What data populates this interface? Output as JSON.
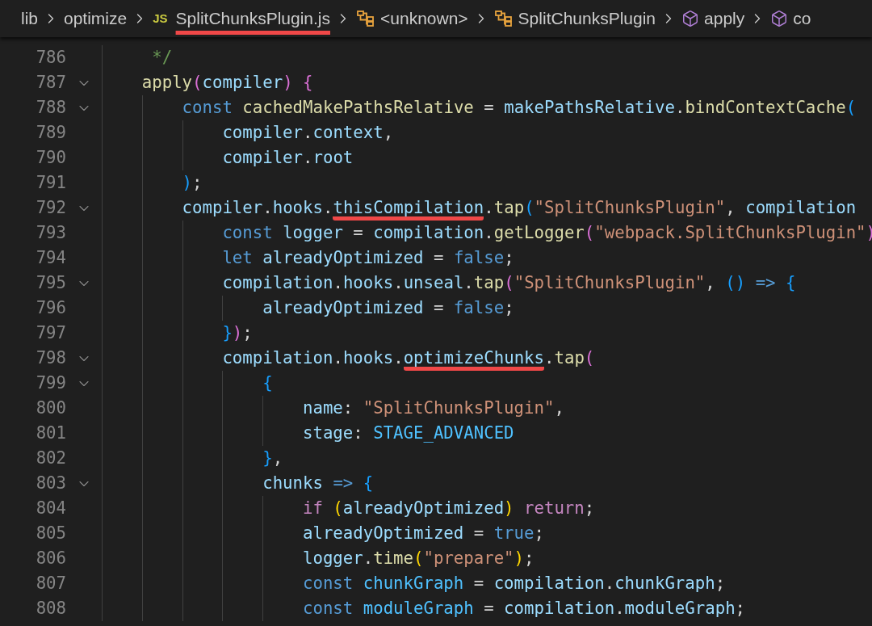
{
  "breadcrumbs": [
    {
      "label": "lib",
      "kind": "folder",
      "underlined": false
    },
    {
      "label": "optimize",
      "kind": "folder",
      "underlined": false
    },
    {
      "label": "SplitChunksPlugin.js",
      "kind": "file",
      "badge": "JS",
      "underlined": true
    },
    {
      "label": "<unknown>",
      "kind": "namespace",
      "underlined": false
    },
    {
      "label": "SplitChunksPlugin",
      "kind": "namespace",
      "underlined": false
    },
    {
      "label": "apply",
      "kind": "method",
      "underlined": false
    },
    {
      "label": "co",
      "kind": "method",
      "underlined": false
    }
  ],
  "lines": [
    {
      "number": "786",
      "foldable": false,
      "tokens": [
        {
          "kind": "comment",
          "text": "     */"
        }
      ]
    },
    {
      "number": "787",
      "foldable": true,
      "tokens": [
        {
          "kind": "func",
          "text": "    apply"
        },
        {
          "kind": "pink",
          "text": "("
        },
        {
          "kind": "var",
          "text": "compiler"
        },
        {
          "kind": "pink",
          "text": ")"
        },
        {
          "kind": "pink",
          "text": " {"
        }
      ]
    },
    {
      "number": "788",
      "foldable": true,
      "tokens": [
        {
          "kind": "keyword",
          "text": "        const"
        },
        {
          "kind": "func",
          "text": " cachedMakePathsRelative"
        },
        {
          "kind": "punct",
          "text": " = "
        },
        {
          "kind": "var",
          "text": "makePathsRelative"
        },
        {
          "kind": "punct",
          "text": "."
        },
        {
          "kind": "func",
          "text": "bindContextCache"
        },
        {
          "kind": "blue",
          "text": "("
        }
      ]
    },
    {
      "number": "789",
      "foldable": false,
      "tokens": [
        {
          "kind": "var",
          "text": "            compiler"
        },
        {
          "kind": "punct",
          "text": "."
        },
        {
          "kind": "var",
          "text": "context"
        },
        {
          "kind": "punct",
          "text": ","
        }
      ]
    },
    {
      "number": "790",
      "foldable": false,
      "tokens": [
        {
          "kind": "var",
          "text": "            compiler"
        },
        {
          "kind": "punct",
          "text": "."
        },
        {
          "kind": "var",
          "text": "root"
        }
      ]
    },
    {
      "number": "791",
      "foldable": false,
      "tokens": [
        {
          "kind": "blue",
          "text": "        )"
        },
        {
          "kind": "punct",
          "text": ";"
        }
      ]
    },
    {
      "number": "792",
      "foldable": true,
      "tokens": [
        {
          "kind": "var",
          "text": "        compiler"
        },
        {
          "kind": "punct",
          "text": "."
        },
        {
          "kind": "var",
          "text": "hooks"
        },
        {
          "kind": "punct",
          "text": "."
        },
        {
          "kind": "var",
          "text": "thisCompilation",
          "underlined": true
        },
        {
          "kind": "punct",
          "text": "."
        },
        {
          "kind": "func",
          "text": "tap"
        },
        {
          "kind": "blue",
          "text": "("
        },
        {
          "kind": "string",
          "text": "\"SplitChunksPlugin\""
        },
        {
          "kind": "punct",
          "text": ", "
        },
        {
          "kind": "var",
          "text": "compilation"
        }
      ]
    },
    {
      "number": "793",
      "foldable": false,
      "tokens": [
        {
          "kind": "keyword",
          "text": "            const"
        },
        {
          "kind": "var",
          "text": " logger"
        },
        {
          "kind": "punct",
          "text": " = "
        },
        {
          "kind": "var",
          "text": "compilation"
        },
        {
          "kind": "punct",
          "text": "."
        },
        {
          "kind": "func",
          "text": "getLogger"
        },
        {
          "kind": "pink",
          "text": "("
        },
        {
          "kind": "string",
          "text": "\"webpack.SplitChunksPlugin\""
        },
        {
          "kind": "pink",
          "text": ")"
        }
      ]
    },
    {
      "number": "794",
      "foldable": false,
      "tokens": [
        {
          "kind": "keyword",
          "text": "            let"
        },
        {
          "kind": "var",
          "text": " alreadyOptimized"
        },
        {
          "kind": "punct",
          "text": " = "
        },
        {
          "kind": "keyword",
          "text": "false"
        },
        {
          "kind": "punct",
          "text": ";"
        }
      ]
    },
    {
      "number": "795",
      "foldable": true,
      "tokens": [
        {
          "kind": "var",
          "text": "            compilation"
        },
        {
          "kind": "punct",
          "text": "."
        },
        {
          "kind": "var",
          "text": "hooks"
        },
        {
          "kind": "punct",
          "text": "."
        },
        {
          "kind": "var",
          "text": "unseal"
        },
        {
          "kind": "punct",
          "text": "."
        },
        {
          "kind": "func",
          "text": "tap"
        },
        {
          "kind": "pink",
          "text": "("
        },
        {
          "kind": "string",
          "text": "\"SplitChunksPlugin\""
        },
        {
          "kind": "punct",
          "text": ", "
        },
        {
          "kind": "blue",
          "text": "()"
        },
        {
          "kind": "keyword",
          "text": " =>"
        },
        {
          "kind": "blue",
          "text": " {"
        }
      ]
    },
    {
      "number": "796",
      "foldable": false,
      "tokens": [
        {
          "kind": "var",
          "text": "                alreadyOptimized"
        },
        {
          "kind": "punct",
          "text": " = "
        },
        {
          "kind": "keyword",
          "text": "false"
        },
        {
          "kind": "punct",
          "text": ";"
        }
      ]
    },
    {
      "number": "797",
      "foldable": false,
      "tokens": [
        {
          "kind": "blue",
          "text": "            }"
        },
        {
          "kind": "pink",
          "text": ")"
        },
        {
          "kind": "punct",
          "text": ";"
        }
      ]
    },
    {
      "number": "798",
      "foldable": true,
      "tokens": [
        {
          "kind": "var",
          "text": "            compilation"
        },
        {
          "kind": "punct",
          "text": "."
        },
        {
          "kind": "var",
          "text": "hooks"
        },
        {
          "kind": "punct",
          "text": "."
        },
        {
          "kind": "var",
          "text": "optimizeChunks",
          "underlined": true
        },
        {
          "kind": "punct",
          "text": "."
        },
        {
          "kind": "func",
          "text": "tap"
        },
        {
          "kind": "pink",
          "text": "("
        }
      ]
    },
    {
      "number": "799",
      "foldable": true,
      "tokens": [
        {
          "kind": "blue",
          "text": "                {"
        }
      ]
    },
    {
      "number": "800",
      "foldable": false,
      "tokens": [
        {
          "kind": "var",
          "text": "                    name"
        },
        {
          "kind": "punct",
          "text": ": "
        },
        {
          "kind": "string",
          "text": "\"SplitChunksPlugin\""
        },
        {
          "kind": "punct",
          "text": ","
        }
      ]
    },
    {
      "number": "801",
      "foldable": false,
      "tokens": [
        {
          "kind": "var",
          "text": "                    stage"
        },
        {
          "kind": "punct",
          "text": ": "
        },
        {
          "kind": "constant",
          "text": "STAGE_ADVANCED"
        }
      ]
    },
    {
      "number": "802",
      "foldable": false,
      "tokens": [
        {
          "kind": "blue",
          "text": "                }"
        },
        {
          "kind": "punct",
          "text": ","
        }
      ]
    },
    {
      "number": "803",
      "foldable": true,
      "tokens": [
        {
          "kind": "var",
          "text": "                chunks"
        },
        {
          "kind": "keyword",
          "text": " =>"
        },
        {
          "kind": "blue",
          "text": " {"
        }
      ]
    },
    {
      "number": "804",
      "foldable": false,
      "tokens": [
        {
          "kind": "control",
          "text": "                    if"
        },
        {
          "kind": "gold",
          "text": " ("
        },
        {
          "kind": "var",
          "text": "alreadyOptimized"
        },
        {
          "kind": "gold",
          "text": ")"
        },
        {
          "kind": "control",
          "text": " return"
        },
        {
          "kind": "punct",
          "text": ";"
        }
      ]
    },
    {
      "number": "805",
      "foldable": false,
      "tokens": [
        {
          "kind": "var",
          "text": "                    alreadyOptimized"
        },
        {
          "kind": "punct",
          "text": " = "
        },
        {
          "kind": "keyword",
          "text": "true"
        },
        {
          "kind": "punct",
          "text": ";"
        }
      ]
    },
    {
      "number": "806",
      "foldable": false,
      "tokens": [
        {
          "kind": "var",
          "text": "                    logger"
        },
        {
          "kind": "punct",
          "text": "."
        },
        {
          "kind": "func",
          "text": "time"
        },
        {
          "kind": "gold",
          "text": "("
        },
        {
          "kind": "string",
          "text": "\"prepare\""
        },
        {
          "kind": "gold",
          "text": ")"
        },
        {
          "kind": "punct",
          "text": ";"
        }
      ]
    },
    {
      "number": "807",
      "foldable": false,
      "tokens": [
        {
          "kind": "keyword",
          "text": "                    const"
        },
        {
          "kind": "constant",
          "text": " chunkGraph"
        },
        {
          "kind": "punct",
          "text": " = "
        },
        {
          "kind": "var",
          "text": "compilation"
        },
        {
          "kind": "punct",
          "text": "."
        },
        {
          "kind": "var",
          "text": "chunkGraph"
        },
        {
          "kind": "punct",
          "text": ";"
        }
      ]
    },
    {
      "number": "808",
      "foldable": false,
      "tokens": [
        {
          "kind": "keyword",
          "text": "                    const"
        },
        {
          "kind": "constant",
          "text": " moduleGraph"
        },
        {
          "kind": "punct",
          "text": " = "
        },
        {
          "kind": "var",
          "text": "compilation"
        },
        {
          "kind": "punct",
          "text": "."
        },
        {
          "kind": "var",
          "text": "moduleGraph"
        },
        {
          "kind": "punct",
          "text": ";"
        }
      ]
    }
  ]
}
